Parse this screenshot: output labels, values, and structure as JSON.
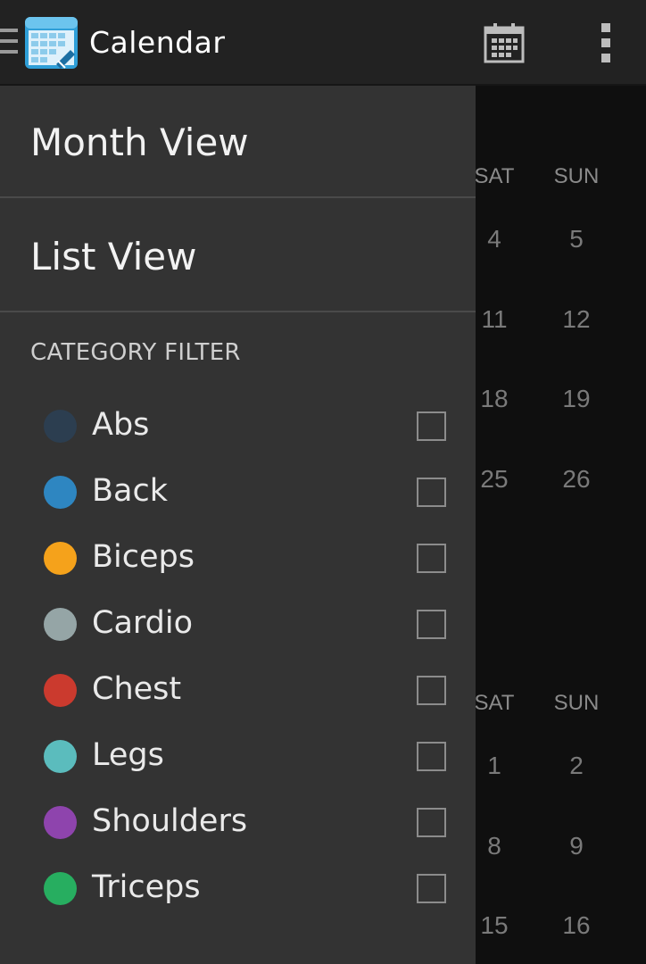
{
  "action_bar": {
    "title": "Calendar",
    "app_icon_name": "app-calendar-logo-icon",
    "calendar_icon_name": "calendar-icon",
    "overflow_icon_name": "overflow-menu-icon",
    "background": "#222222"
  },
  "drawer": {
    "nav_items": [
      {
        "label": "Month View"
      },
      {
        "label": "List View"
      }
    ],
    "section_header": "CATEGORY FILTER",
    "categories": [
      {
        "label": "Abs",
        "color": "#2c3e50",
        "checked": false
      },
      {
        "label": "Back",
        "color": "#2e86c1",
        "checked": false
      },
      {
        "label": "Biceps",
        "color": "#f5a21b",
        "checked": false
      },
      {
        "label": "Cardio",
        "color": "#95a5a6",
        "checked": false
      },
      {
        "label": "Chest",
        "color": "#cb3a2e",
        "checked": false
      },
      {
        "label": "Legs",
        "color": "#5bbcbd",
        "checked": false
      },
      {
        "label": "Shoulders",
        "color": "#8e44ad",
        "checked": false
      },
      {
        "label": "Triceps",
        "color": "#27ae60",
        "checked": false
      }
    ]
  },
  "background_calendar": {
    "block1": {
      "headers": [
        "SAT",
        "SUN"
      ],
      "rows": [
        [
          "4",
          "5"
        ],
        [
          "11",
          "12"
        ],
        [
          "18",
          "19"
        ],
        [
          "25",
          "26"
        ]
      ]
    },
    "block2": {
      "headers": [
        "SAT",
        "SUN"
      ],
      "rows": [
        [
          "1",
          "2"
        ],
        [
          "8",
          "9"
        ],
        [
          "15",
          "16"
        ]
      ]
    }
  }
}
